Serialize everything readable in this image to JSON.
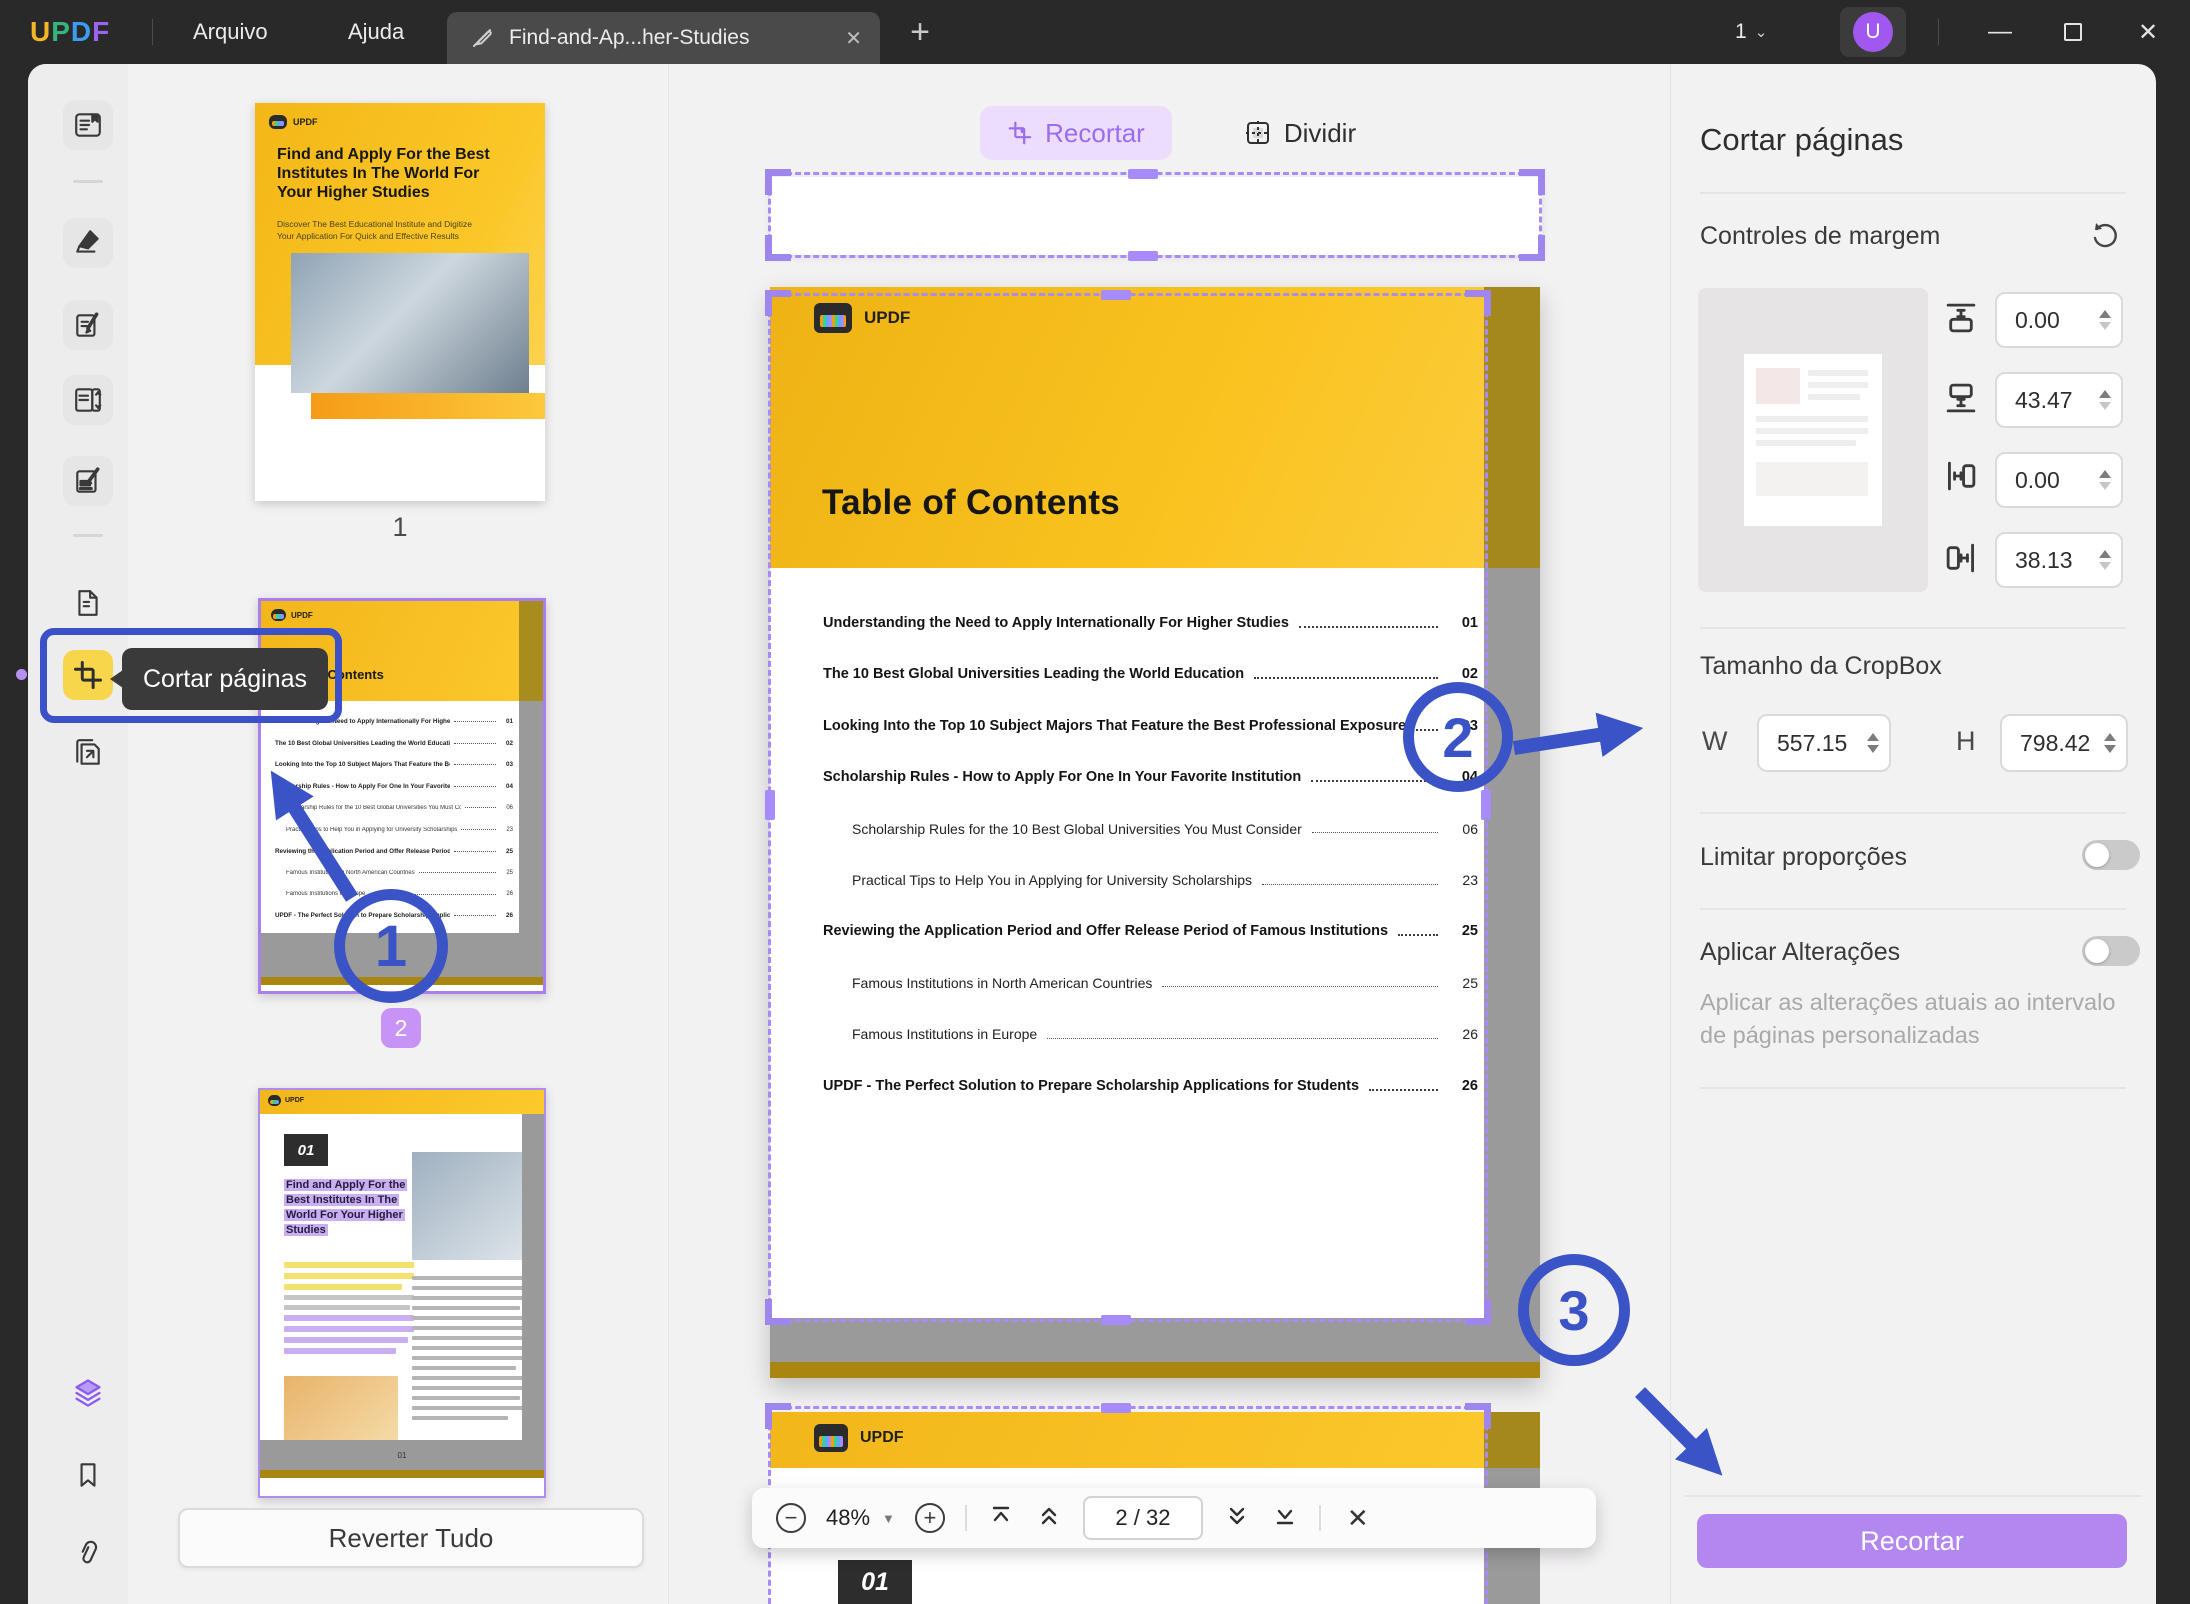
{
  "titlebar": {
    "logo": "UPDF",
    "menu_arquivo": "Arquivo",
    "menu_ajuda": "Ajuda",
    "tab_title": "Find-and-Ap...her-Studies",
    "tab_close": "✕",
    "new_tab": "+",
    "page_count": "1",
    "avatar_initial": "U",
    "minimize": "—",
    "close": "✕"
  },
  "sidebar": {
    "icons": [
      "reader-icon",
      "highlighter-icon",
      "edit-icon",
      "organize-pages-icon",
      "fill-sign-icon",
      "page-tools-icon",
      "crop-pages-icon",
      "extract-pages-icon",
      "layers-icon",
      "bookmark-icon",
      "attachment-icon"
    ],
    "tooltip": "Cortar páginas"
  },
  "thumbnails": {
    "page1": {
      "logo": "UPDF",
      "title": "Find and Apply For the Best Institutes In The World For Your Higher Studies",
      "subtitle": "Discover The Best Educational Institute and Digitize Your Application For Quick and Effective Results",
      "label": "1"
    },
    "page2": {
      "badge": "2"
    },
    "page3": {
      "number_badge": "01",
      "footer": "01"
    },
    "revert_all": "Reverter Tudo"
  },
  "top_toolbar": {
    "crop_tab": "Recortar",
    "split_tab": "Dividir"
  },
  "document": {
    "logo": "UPDF",
    "title": "Table of Contents",
    "page3_number_badge": "01",
    "toc": [
      {
        "text": "Understanding the Need to Apply Internationally For Higher Studies",
        "page": "01",
        "level": 0
      },
      {
        "text": "The 10 Best Global Universities Leading the World Education",
        "page": "02",
        "level": 0
      },
      {
        "text": "Looking Into the Top 10 Subject Majors That Feature the Best Professional Exposure",
        "page": "03",
        "level": 0
      },
      {
        "text": "Scholarship Rules - How to Apply For One In Your Favorite Institution",
        "page": "04",
        "level": 0
      },
      {
        "text": "Scholarship Rules for the 10 Best Global Universities You Must Consider",
        "page": "06",
        "level": 1
      },
      {
        "text": "Practical Tips to Help You in Applying for University Scholarships",
        "page": "23",
        "level": 1
      },
      {
        "text": "Reviewing the Application Period and Offer Release Period of Famous Institutions",
        "page": "25",
        "level": 0
      },
      {
        "text": "Famous Institutions in North American Countries",
        "page": "25",
        "level": 1
      },
      {
        "text": "Famous Institutions in Europe",
        "page": "26",
        "level": 1
      },
      {
        "text": "UPDF - The Perfect Solution to Prepare Scholarship Applications for Students",
        "page": "26",
        "level": 0
      }
    ]
  },
  "annotations": {
    "step1": "1",
    "step2": "2",
    "step3": "3"
  },
  "bottom_toolbar": {
    "zoom_out": "−",
    "zoom_level": "48%",
    "zoom_in": "+",
    "page_indicator": "2 / 32",
    "close": "✕"
  },
  "right_panel": {
    "title": "Cortar páginas",
    "margin_controls_label": "Controles de margem",
    "margin_top": "0.00",
    "margin_bottom": "43.47",
    "margin_left": "0.00",
    "margin_right": "38.13",
    "cropbox_label": "Tamanho da CropBox",
    "width_label": "W",
    "width_value": "557.15",
    "height_label": "H",
    "height_value": "798.42",
    "limit_proportions_label": "Limitar proporções",
    "apply_changes_label": "Aplicar Alterações",
    "apply_changes_desc": "Aplicar as alterações atuais ao intervalo de páginas personalizadas",
    "crop_button": "Recortar"
  },
  "colors": {
    "accent_purple": "#9c6ef0",
    "annotation_blue": "#3a53c6",
    "doc_yellow": "#f8c21b",
    "selection_dash": "#a78bfa",
    "button_purple": "#b287ef",
    "crop_tool_highlight": "#f7d64b"
  }
}
